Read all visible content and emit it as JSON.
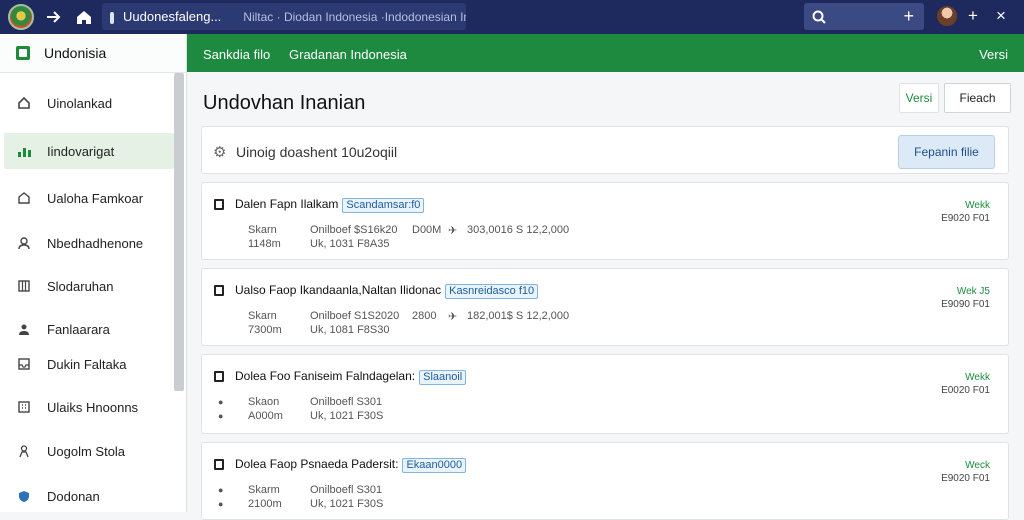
{
  "browser": {
    "url_title": "Uudonesfaleng...",
    "url_path": "Niltac · Diodan Indonesia  ·Indodonesian  Indonadan",
    "icons": [
      "logo-icon",
      "arrow-right-icon",
      "home-icon",
      "lock-icon",
      "search-icon",
      "plus-icon",
      "avatar",
      "close-icon"
    ]
  },
  "sidebar": {
    "header": "Undonisia",
    "items": [
      {
        "label": "Uinolankad",
        "icon": "home-icon"
      },
      {
        "label": "Iindovarigat",
        "icon": "chart-icon",
        "active": true
      },
      {
        "label": "Ualoha Famkoar",
        "icon": "house-icon"
      },
      {
        "label": "Nbedhadhenone",
        "icon": "user-icon"
      },
      {
        "label": "Slodaruhan",
        "icon": "grid-icon"
      },
      {
        "label": "Fanlaarara",
        "icon": "user-icon"
      },
      {
        "label": "Dukin Faltaka",
        "icon": "inbox-icon"
      },
      {
        "label": "Ulaiks Hnoonns",
        "icon": "building-icon"
      },
      {
        "label": "Uogolm Stola",
        "icon": "person-icon"
      },
      {
        "label": "Dodonan",
        "icon": "shield-icon"
      }
    ]
  },
  "topnav": {
    "tab1": "Sankdia filo",
    "tab2": "Gradanan Indonesia",
    "right": "Versi"
  },
  "main": {
    "title": "Undovhan Inanian",
    "btn_versi": "Versi",
    "btn_fieach": "Fieach",
    "filter_text": "Uinoig doashent 10u2oqiil",
    "filter_button": "Fepanin filie",
    "cards": [
      {
        "title": "Dalen Fapn Ilalkam",
        "badge": "Scandamsar:f0",
        "m1": "Skarn",
        "m2": "Onilboef $S16k20",
        "m3": "D00M",
        "m4": "303,0016 S 12,2,000",
        "n1": "1148m",
        "n2": "Uk, 1031 F8A35",
        "status": "Wekk",
        "sub": "E9020 F01"
      },
      {
        "title": "Ualso Faop Ikandaanla,Naltan Ilidonac",
        "badge": "Kasnreidasco f10",
        "m1": "Skarn",
        "m2": "Onilboef S1S2020",
        "m3": "2800",
        "m4": "182,001$ S 12,2,000",
        "n1": "7300m",
        "n2": "Uk, 1081 F8S30",
        "status": "Wek J5",
        "sub": "E9090 F01"
      },
      {
        "title": "Dolea Foo Faniseim Falndagelan:",
        "badge": "Slaanoil",
        "m1": "Skaon",
        "m2": "Onilboefl S301",
        "m3": "",
        "m4": "",
        "n1": "A000m",
        "n2": "Uk, 1021 F30S",
        "status": "Wekk",
        "sub": "E0020 F01"
      },
      {
        "title": "Dolea Faop Psnaeda Padersit:",
        "badge": "Ekaan0000",
        "m1": "Skarm",
        "m2": "Onilboefl S301",
        "m3": "",
        "m4": "",
        "n1": "2100m",
        "n2": "Uk, 1021 F30S",
        "status": "Weck",
        "sub": "E9020 F01"
      }
    ]
  }
}
